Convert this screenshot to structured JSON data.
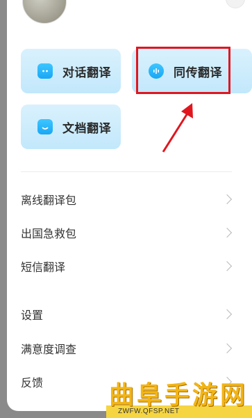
{
  "cards": {
    "dialog": "对话翻译",
    "simultaneous": "同传翻译",
    "document": "文档翻译"
  },
  "menu": [
    {
      "label": "离线翻译包"
    },
    {
      "label": "出国急救包"
    },
    {
      "label": "短信翻译"
    },
    {
      "label": "设置"
    },
    {
      "label": "满意度调查"
    },
    {
      "label": "反馈"
    }
  ],
  "watermark": {
    "title": "曲阜手游网",
    "url": "ZWFW.QFSP.NET"
  },
  "colors": {
    "card_bg": "#c7eafb",
    "icon_blue": "#1ea9f6",
    "highlight_red": "#e0161f",
    "arrow_red": "#e0161f"
  }
}
